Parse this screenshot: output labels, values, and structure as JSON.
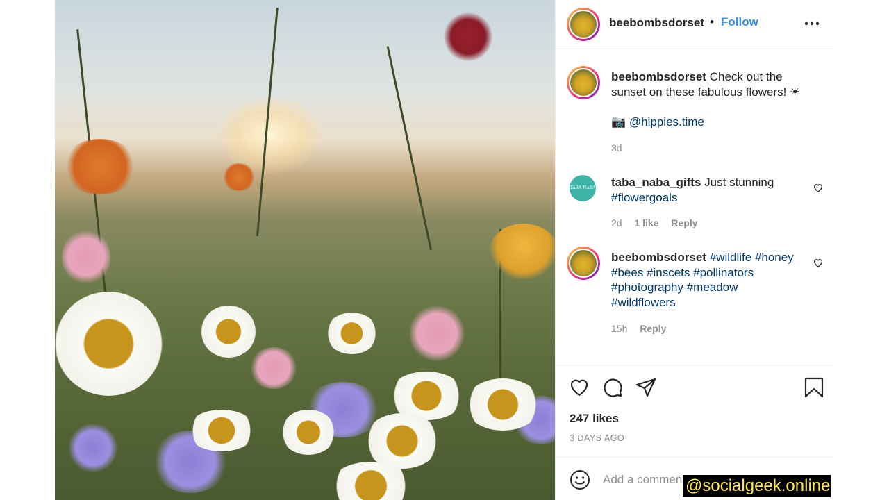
{
  "post": {
    "author": "beebombsdorset",
    "separator": "•",
    "follow_label": "Follow",
    "caption": {
      "username": "beebombsdorset",
      "text": "Check out the sunset on these fabulous flowers! ☀",
      "credit_icon": "📷",
      "credit_handle": "@hippies.time",
      "time": "3d"
    },
    "comments": [
      {
        "username": "taba_naba_gifts",
        "text": "Just stunning",
        "hashtags": "#flowergoals",
        "time": "2d",
        "likes": "1 like",
        "reply": "Reply",
        "avatar_text": "TABA NABA"
      },
      {
        "username": "beebombsdorset",
        "hashtags_line1": "#wildlife #honey",
        "hashtags_line2": "#bees #inscets #pollinators",
        "hashtags_line3": "#photography #meadow",
        "hashtags_line4": "#wildflowers",
        "time": "15h",
        "reply": "Reply"
      }
    ],
    "likes": "247 likes",
    "posted_ago": "3 DAYS AGO",
    "add_comment_placeholder": "Add a comment..."
  },
  "icons": [
    "more-icon",
    "heart-icon",
    "comment-icon",
    "share-icon",
    "bookmark-icon",
    "emoji-icon"
  ],
  "colors": {
    "link": "#00376b",
    "follow": "#3b93e6",
    "meta": "#8e8e8e"
  },
  "watermark": "@socialgeek.online"
}
